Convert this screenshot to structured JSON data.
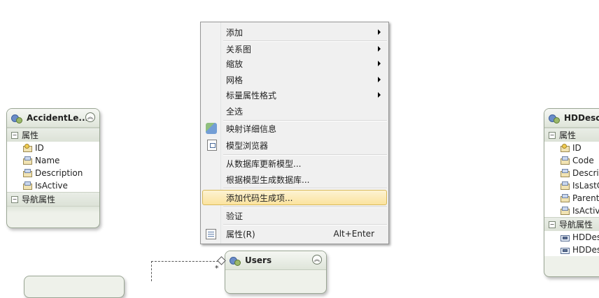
{
  "entities": {
    "accident": {
      "title": "AccidentLe...",
      "properties_label": "属性",
      "properties": [
        "ID",
        "Name",
        "Description",
        "IsActive"
      ],
      "nav_label": "导航属性"
    },
    "hd": {
      "title": "HDDescr",
      "properties_label": "属性",
      "properties": [
        "ID",
        "Code",
        "Descrip",
        "IsLastC",
        "Parent",
        "IsActiv"
      ],
      "nav_label": "导航属性",
      "nav_properties": [
        "HDDes",
        "HDDes"
      ]
    },
    "users": {
      "title": "Users"
    }
  },
  "association": {
    "multiplicity": "*"
  },
  "context_menu": {
    "items": [
      {
        "label": "添加",
        "submenu": true
      },
      {
        "label": "关系图",
        "submenu": true
      },
      {
        "label": "缩放",
        "submenu": true
      },
      {
        "label": "网格",
        "submenu": true
      },
      {
        "label": "标量属性格式",
        "submenu": true
      },
      {
        "label": "全选"
      },
      {
        "label": "映射详细信息",
        "icon": "mapping-details-icon"
      },
      {
        "label": "模型浏览器",
        "icon": "model-browser-icon"
      },
      {
        "label": "从数据库更新模型..."
      },
      {
        "label": "根据模型生成数据库..."
      },
      {
        "label": "添加代码生成项...",
        "highlighted": true
      },
      {
        "label": "验证"
      },
      {
        "label": "属性(R)",
        "shortcut": "Alt+Enter",
        "icon": "properties-icon"
      }
    ]
  }
}
